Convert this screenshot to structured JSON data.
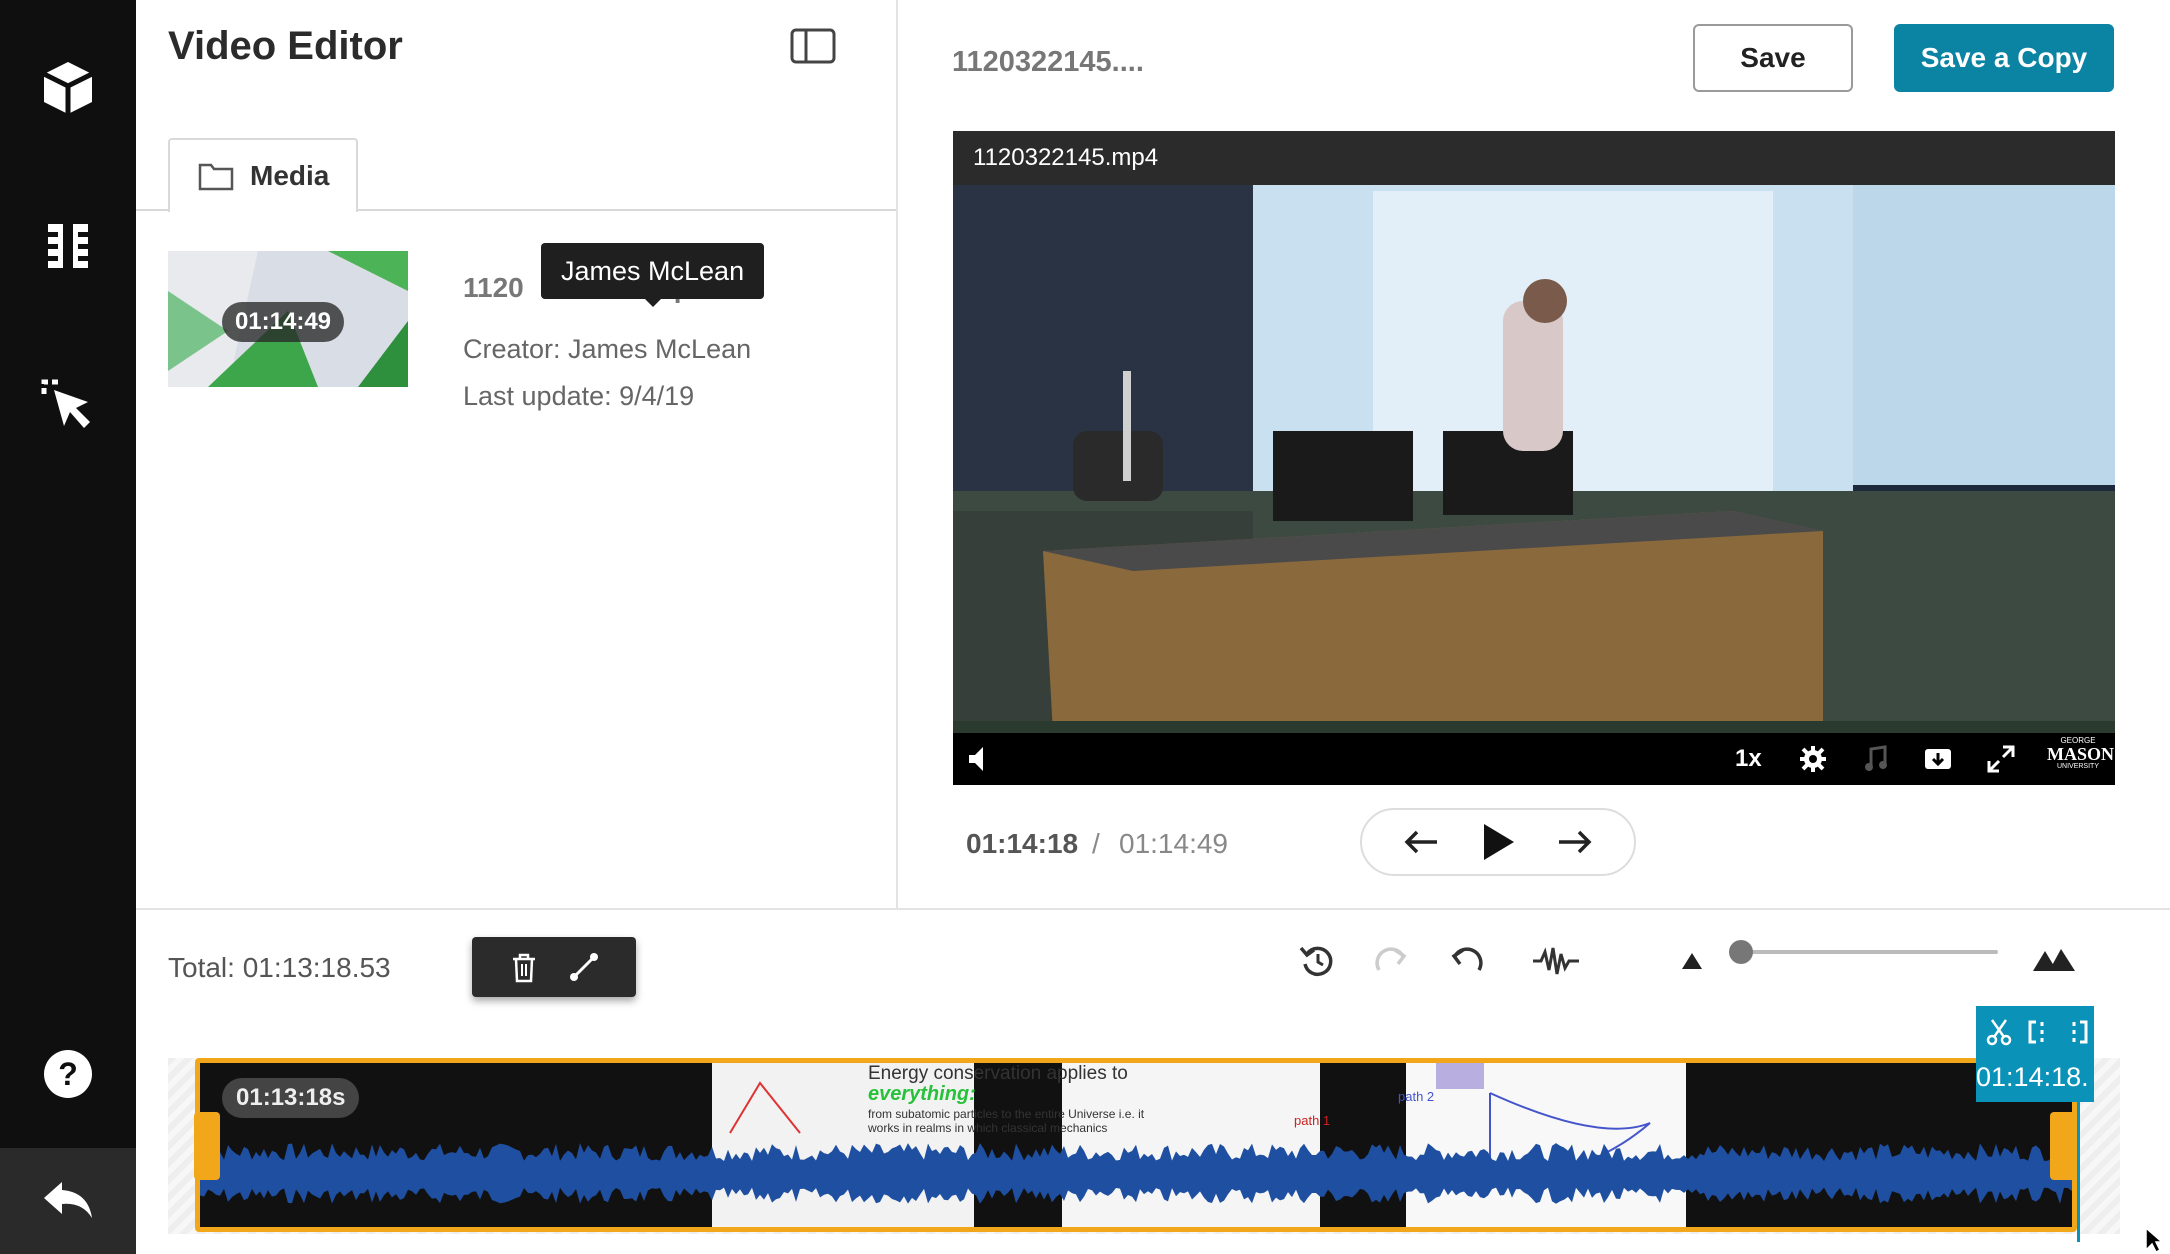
{
  "sidebar": {
    "icons": [
      "cube-icon",
      "film-strip-icon",
      "cursor-click-icon",
      "help-icon",
      "back-icon"
    ]
  },
  "editor": {
    "title": "Video Editor",
    "media_tab_label": "Media"
  },
  "media_item": {
    "duration": "01:14:49",
    "name_visible": "1120",
    "name_trailing": "p4",
    "creator": "Creator: James McLean",
    "last_update": "Last update: 9/4/19",
    "tooltip": "James McLean"
  },
  "header": {
    "file_title": "1120322145....",
    "save_label": "Save",
    "save_copy_label": "Save a Copy"
  },
  "player": {
    "file_name": "1120322145.mp4",
    "speed": "1x",
    "brand_line1": "GEORGE",
    "brand_line2": "MASON",
    "brand_line3": "UNIVERSITY"
  },
  "playback": {
    "current": "01:14:18",
    "separator": "/",
    "total": "01:14:49"
  },
  "timeline": {
    "total_label": "Total: 01:13:18.53",
    "clip_label": "01:13:18s",
    "playhead_time": "01:14:18.",
    "zoom_level": 0.02,
    "slide_text_1": "Energy conservation applies to",
    "slide_text_2": "everything:",
    "slide_text_3": "from subatomic particles to the entire Universe i.e. it",
    "slide_text_4": "works in realms in which classical mechanics",
    "slide_text_5": "path 1",
    "slide_text_6": "path 2"
  },
  "colors": {
    "accent": "#0b83a3",
    "clip_border": "#f2a71b",
    "waveform": "#1f4fa0",
    "rail": "#0f0f0f"
  }
}
